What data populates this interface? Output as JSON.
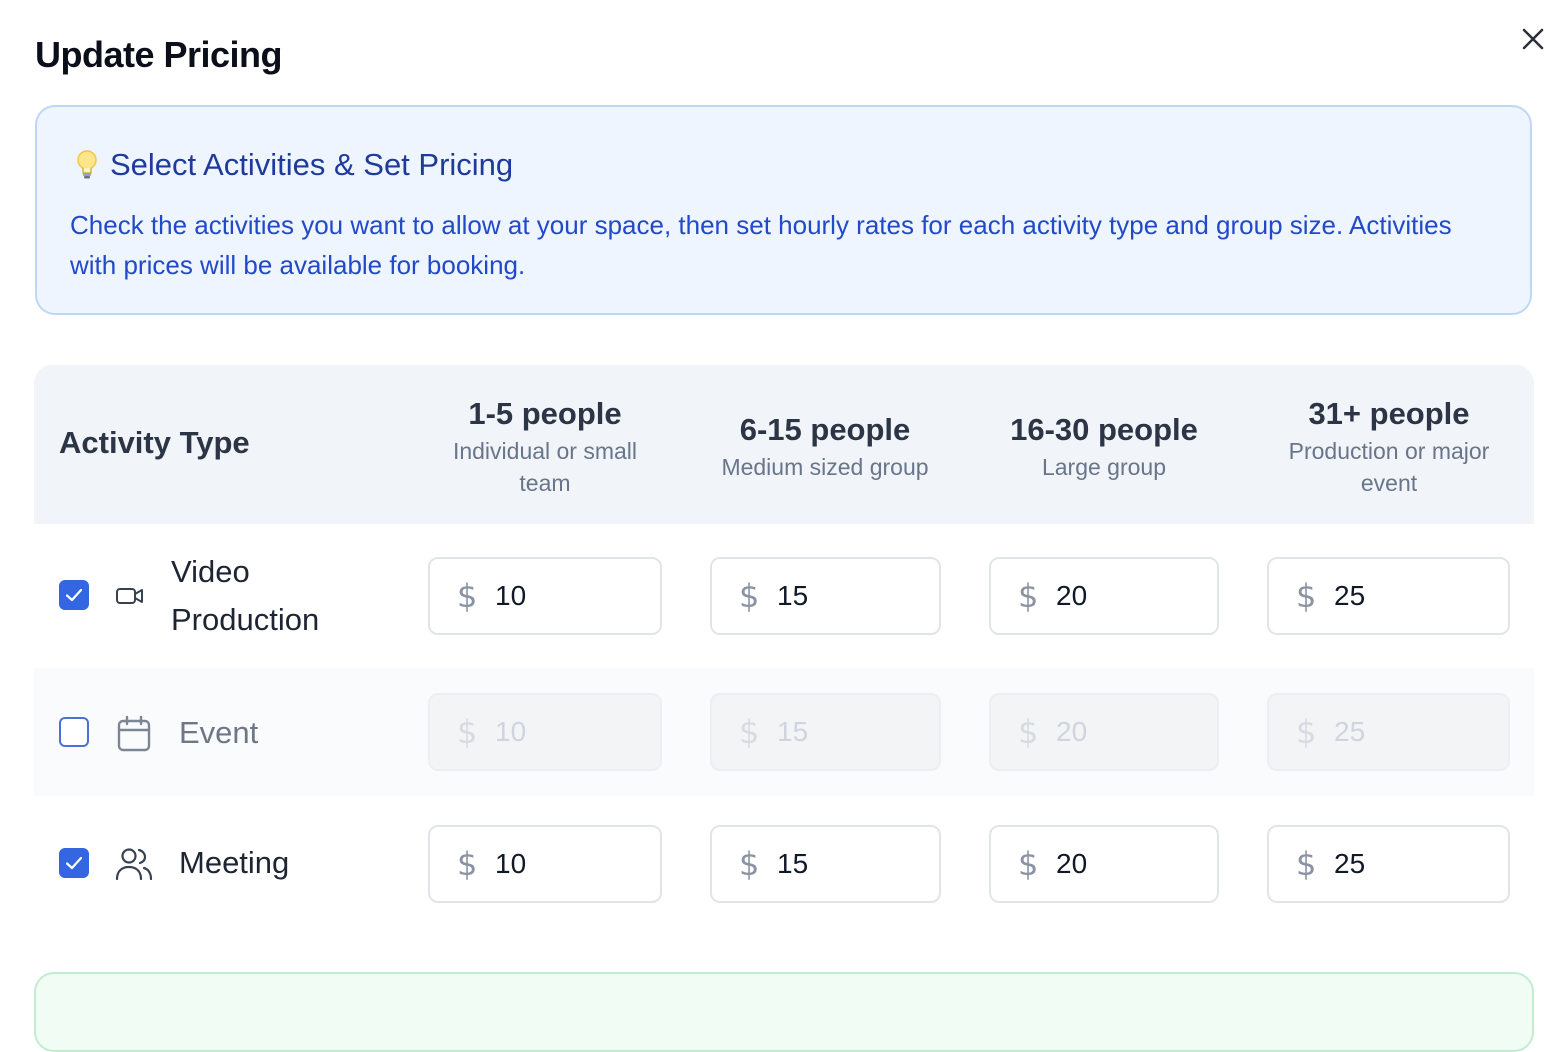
{
  "dialog": {
    "title": "Update Pricing",
    "close_icon": "x-close-icon"
  },
  "info": {
    "icon": "lightbulb-icon",
    "title": "Select Activities & Set Pricing",
    "text": "Check the activities you want to allow at your space, then set hourly rates for each activity type and group size. Activities with prices will be available for booking."
  },
  "table": {
    "activity_header": "Activity Type",
    "columns": [
      {
        "label": "1-5 people",
        "sub": "Individual or small team"
      },
      {
        "label": "6-15 people",
        "sub": "Medium sized group"
      },
      {
        "label": "16-30 people",
        "sub": "Large group"
      },
      {
        "label": "31+ people",
        "sub": "Production or major event"
      }
    ],
    "currency_symbol": "$",
    "rows": [
      {
        "label": "Video Production",
        "icon": "video-camera-icon",
        "checked": true,
        "prices": [
          "10",
          "15",
          "20",
          "25"
        ]
      },
      {
        "label": "Event",
        "icon": "calendar-icon",
        "checked": false,
        "prices": [
          "10",
          "15",
          "20",
          "25"
        ]
      },
      {
        "label": "Meeting",
        "icon": "users-icon",
        "checked": true,
        "prices": [
          "10",
          "15",
          "20",
          "25"
        ]
      }
    ]
  },
  "colors": {
    "accent": "#3366e0",
    "info_bg": "#eef5fe",
    "info_text": "#2249c7",
    "success_bg": "#f1fcf4"
  }
}
